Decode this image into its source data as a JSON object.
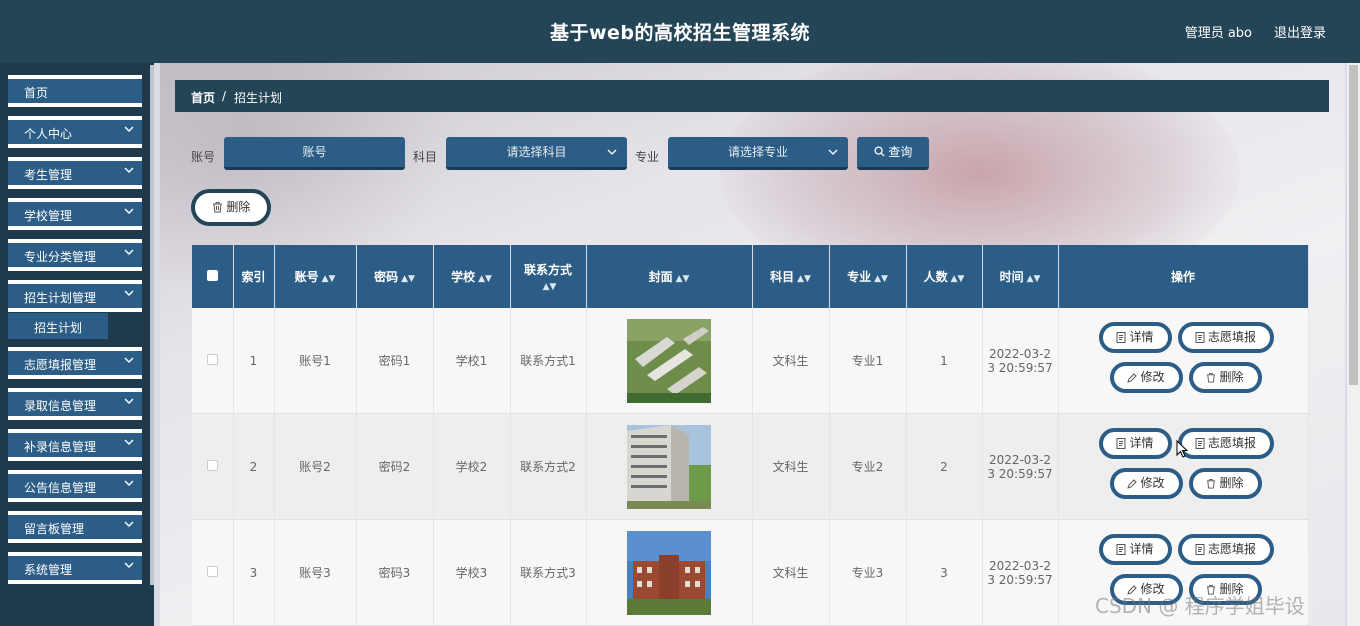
{
  "header": {
    "title": "基于web的高校招生管理系统",
    "user": "管理员 abo",
    "logout": "退出登录"
  },
  "sidebar": {
    "items": [
      {
        "label": "首页",
        "chevron": false
      },
      {
        "label": "个人中心",
        "chevron": true
      },
      {
        "label": "考生管理",
        "chevron": true
      },
      {
        "label": "学校管理",
        "chevron": true
      },
      {
        "label": "专业分类管理",
        "chevron": true
      },
      {
        "label": "招生计划管理",
        "chevron": true
      },
      {
        "label": "志愿填报管理",
        "chevron": true
      },
      {
        "label": "录取信息管理",
        "chevron": true
      },
      {
        "label": "补录信息管理",
        "chevron": true
      },
      {
        "label": "公告信息管理",
        "chevron": true
      },
      {
        "label": "留言板管理",
        "chevron": true
      },
      {
        "label": "系统管理",
        "chevron": true
      }
    ],
    "submenu": "招生计划"
  },
  "breadcrumb": {
    "home": "首页",
    "sep": "/",
    "current": "招生计划"
  },
  "search": {
    "account_label": "账号",
    "account_placeholder": "账号",
    "subject_label": "科目",
    "subject_placeholder": "请选择科目",
    "major_label": "专业",
    "major_placeholder": "请选择专业",
    "query": "查询"
  },
  "actions": {
    "delete": "删除"
  },
  "table": {
    "columns": [
      "索引",
      "账号",
      "密码",
      "学校",
      "联系方式",
      "封面",
      "科目",
      "专业",
      "人数",
      "时间",
      "操作"
    ],
    "rows": [
      {
        "index": "1",
        "account": "账号1",
        "password": "密码1",
        "school": "学校1",
        "contact": "联系方式1",
        "subject": "文科生",
        "major": "专业1",
        "count": "1",
        "time1": "2022-03-2",
        "time2": "3 20:59:57"
      },
      {
        "index": "2",
        "account": "账号2",
        "password": "密码2",
        "school": "学校2",
        "contact": "联系方式2",
        "subject": "文科生",
        "major": "专业2",
        "count": "2",
        "time1": "2022-03-2",
        "time2": "3 20:59:57"
      },
      {
        "index": "3",
        "account": "账号3",
        "password": "密码3",
        "school": "学校3",
        "contact": "联系方式3",
        "subject": "文科生",
        "major": "专业3",
        "count": "3",
        "time1": "2022-03-2",
        "time2": "3 20:59:57"
      }
    ],
    "ops": {
      "detail": "详情",
      "apply": "志愿填报",
      "edit": "修改",
      "delete": "删除"
    }
  },
  "watermark": "CSDN @ 程序学姐毕设",
  "colors": {
    "header": "#244556",
    "accent": "#2b5d86",
    "sidebar": "#1f3a4c"
  }
}
